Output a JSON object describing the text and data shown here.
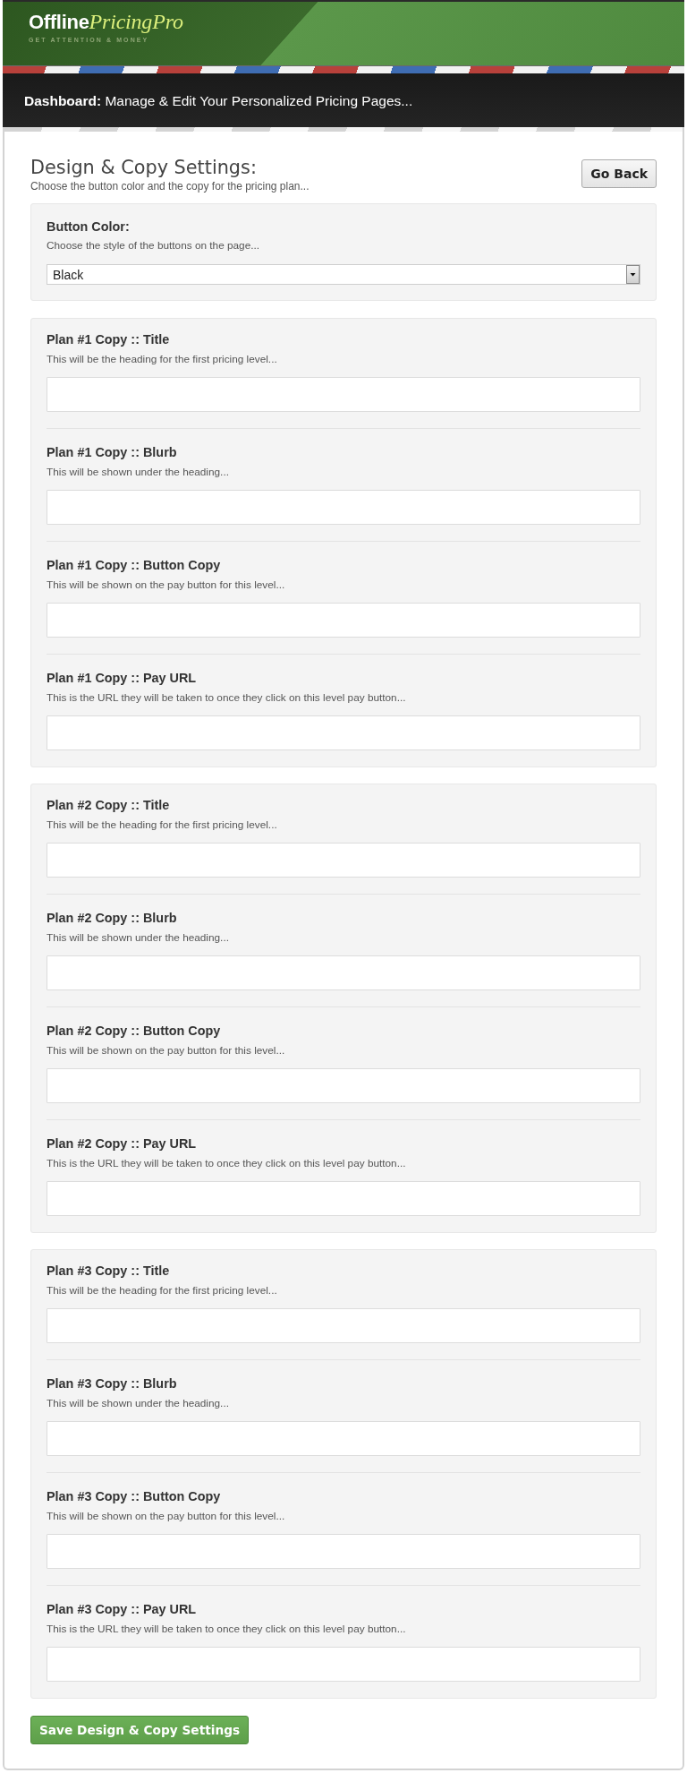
{
  "header": {
    "logo": {
      "primary": "Offline",
      "secondary": "PricingPro"
    },
    "tagline": "GET ATTENTION & MONEY",
    "dashboard_text": "**Dashboard:** Manage & Edit Your Personalized Pricing Pages..."
  },
  "page": {
    "title": "Design & Copy Settings:",
    "subtitle": "Choose the button color and the copy for the pricing plan...",
    "back_button": "Go Back"
  },
  "button_color": {
    "label": "Button Color:",
    "hint": "Choose the style of the buttons on the page...",
    "value": "Black"
  },
  "plans": [
    {
      "fields": [
        {
          "label": "Plan #1 Copy :: Title",
          "hint": "This will be the heading for the first pricing level..."
        },
        {
          "label": "Plan #1 Copy :: Blurb",
          "hint": "This will be shown under the heading..."
        },
        {
          "label": "Plan #1 Copy :: Button Copy",
          "hint": "This will be shown on the pay button for this level..."
        },
        {
          "label": "Plan #1 Copy :: Pay URL",
          "hint": "This is the URL they will be taken to once they click on this level pay button..."
        }
      ]
    },
    {
      "fields": [
        {
          "label": "Plan #2 Copy :: Title",
          "hint": "This will be the heading for the first pricing level..."
        },
        {
          "label": "Plan #2 Copy :: Blurb",
          "hint": "This will be shown under the heading..."
        },
        {
          "label": "Plan #2 Copy :: Button Copy",
          "hint": "This will be shown on the pay button for this level..."
        },
        {
          "label": "Plan #2 Copy :: Pay URL",
          "hint": "This is the URL they will be taken to once they click on this level pay button..."
        }
      ]
    },
    {
      "fields": [
        {
          "label": "Plan #3 Copy :: Title",
          "hint": "This will be the heading for the first pricing level..."
        },
        {
          "label": "Plan #3 Copy :: Blurb",
          "hint": "This will be shown under the heading..."
        },
        {
          "label": "Plan #3 Copy :: Button Copy",
          "hint": "This will be shown on the pay button for this level..."
        },
        {
          "label": "Plan #3 Copy :: Pay URL",
          "hint": "This is the URL they will be taken to once they click on this level pay button..."
        }
      ]
    }
  ],
  "save_button": "Save Design & Copy Settings"
}
